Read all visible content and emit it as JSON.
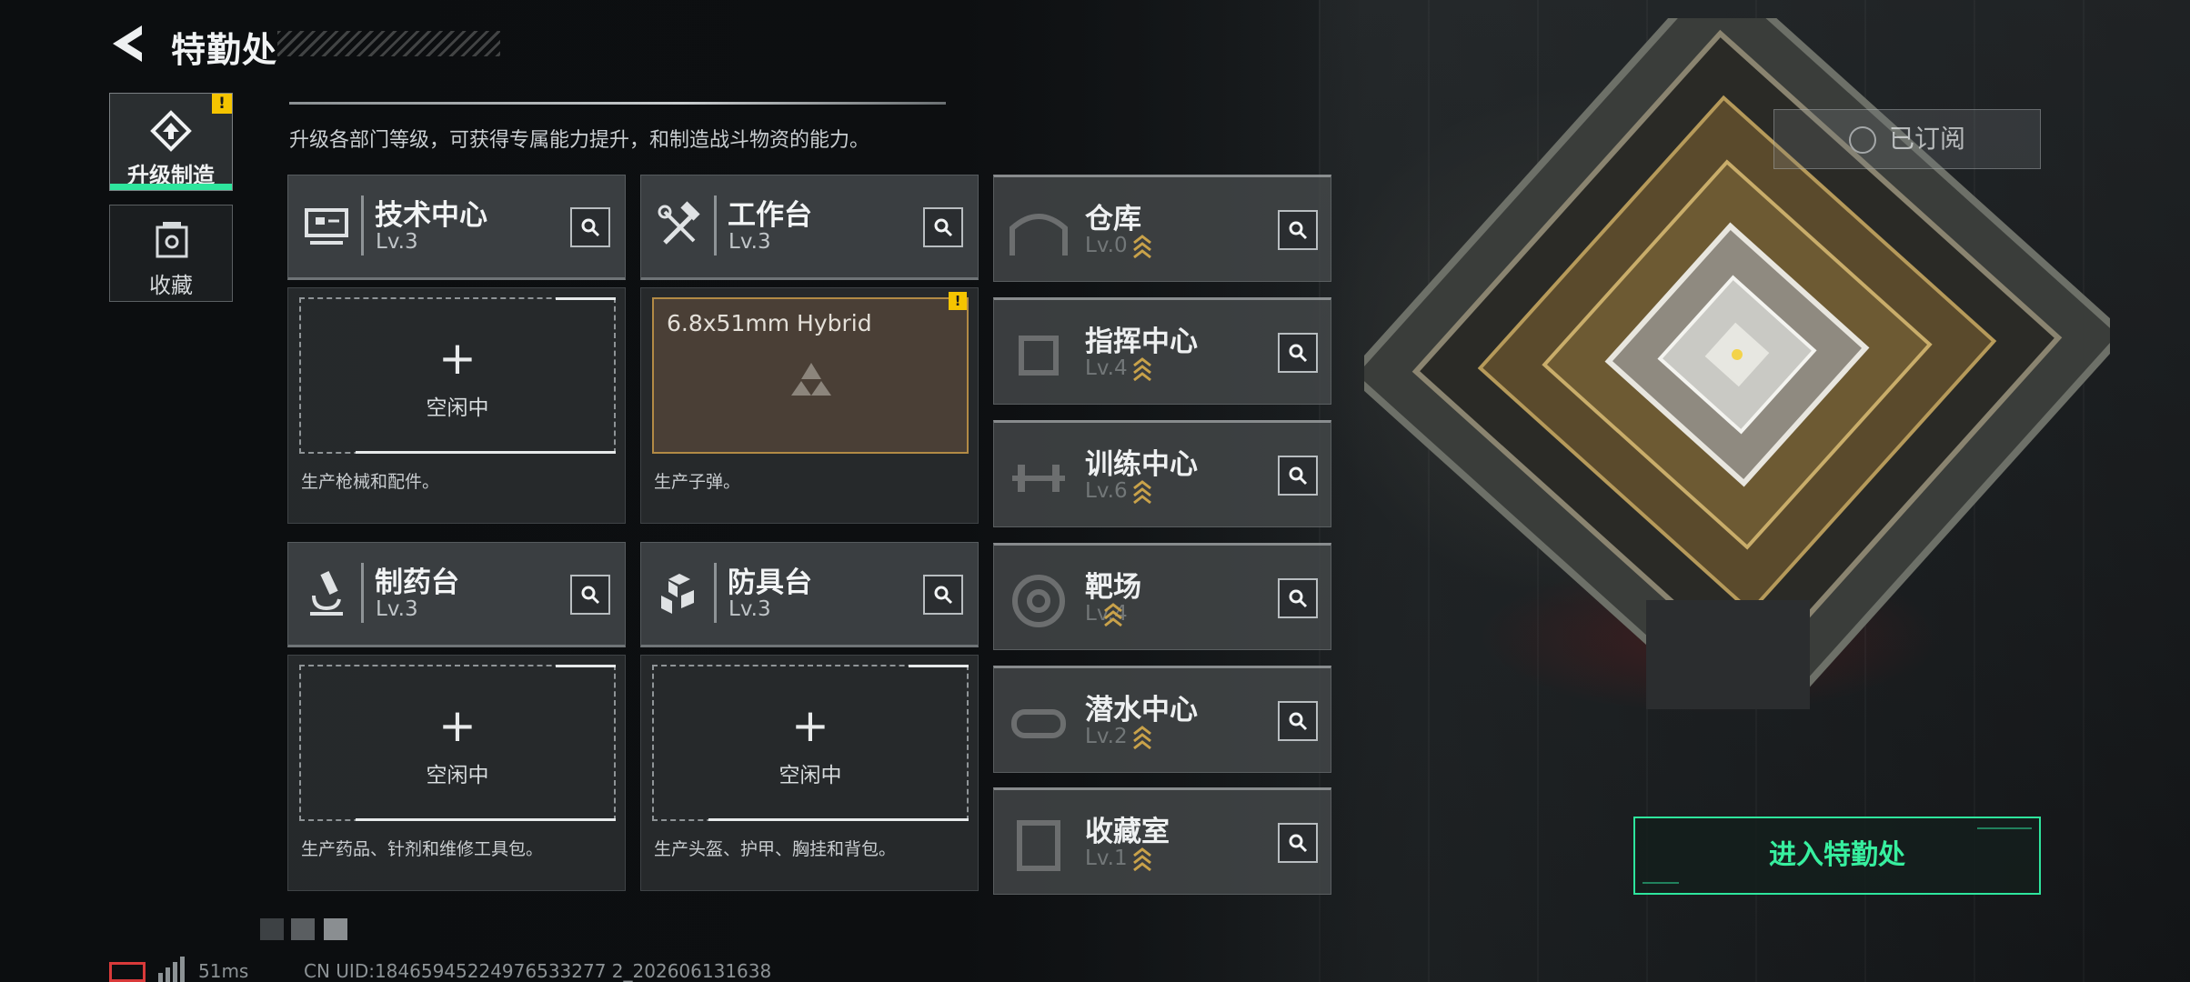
{
  "header": {
    "title": "特勤处"
  },
  "nav": {
    "tabs": [
      {
        "label": "升级制造",
        "active": true,
        "icon": "upgrade-manufacture-icon",
        "badge": "!"
      },
      {
        "label": "收藏",
        "active": false,
        "icon": "collection-icon"
      }
    ]
  },
  "description": "升级各部门等级，可获得专属能力提升，和制造战斗物资的能力。",
  "departments": {
    "tech": {
      "name": "技术中心",
      "level": "Lv.3",
      "icon": "computer-icon",
      "slot_label": "空闲中",
      "desc": "生产枪械和配件。"
    },
    "workbench": {
      "name": "工作台",
      "level": "Lv.3",
      "icon": "hammer-wrench-icon",
      "slot_item": "6.8x51mm Hybrid",
      "badge": "!",
      "desc": "生产子弹。"
    },
    "pharmacy": {
      "name": "制药台",
      "level": "Lv.3",
      "icon": "microscope-icon",
      "slot_label": "空闲中",
      "desc": "生产药品、针剂和维修工具包。"
    },
    "armor": {
      "name": "防具台",
      "level": "Lv.3",
      "icon": "cubes-icon",
      "slot_label": "空闲中",
      "desc": "生产头盔、护甲、胸挂和背包。"
    }
  },
  "right_column": [
    {
      "name": "仓库",
      "level": "Lv.0",
      "icon": "warehouse-icon"
    },
    {
      "name": "指挥中心",
      "level": "Lv.4",
      "icon": "chip-icon"
    },
    {
      "name": "训练中心",
      "level": "Lv.6",
      "icon": "dumbbell-icon"
    },
    {
      "name": "靶场",
      "level": "Lv.4",
      "icon": "target-icon"
    },
    {
      "name": "潜水中心",
      "level": "Lv.2",
      "icon": "diving-mask-icon"
    },
    {
      "name": "收藏室",
      "level": "Lv.1",
      "icon": "collection-room-icon"
    }
  ],
  "subscribed_label": "已订阅",
  "enter_button": "进入特勤处",
  "status": {
    "ping": "51ms",
    "uid": "CN UID:18465945224976533277 2_202606131638"
  },
  "colors": {
    "accent": "#2ee59d",
    "warning": "#f5c400",
    "battery": "#d93a3a",
    "slot_active_border": "#b28a45"
  }
}
